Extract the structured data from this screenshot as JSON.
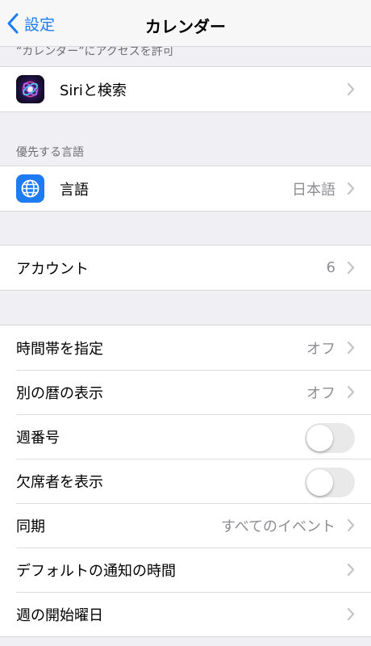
{
  "nav": {
    "back_label": "設定",
    "title": "カレンダー"
  },
  "access_header": "“カレンダー”にアクセスを許可",
  "siri_row": {
    "label": "Siriと検索",
    "icon": "siri-icon"
  },
  "lang_section": {
    "header": "優先する言語",
    "row": {
      "label": "言語",
      "value": "日本語",
      "icon": "globe-icon"
    }
  },
  "accounts": {
    "label": "アカウント",
    "value": "6"
  },
  "settings": {
    "timezone": {
      "label": "時間帯を指定",
      "value": "オフ"
    },
    "alt_calendar": {
      "label": "別の暦の表示",
      "value": "オフ"
    },
    "week_numbers": {
      "label": "週番号",
      "on": false
    },
    "declined": {
      "label": "欠席者を表示",
      "on": false
    },
    "sync": {
      "label": "同期",
      "value": "すべてのイベント"
    },
    "default_alert": {
      "label": "デフォルトの通知の時間"
    },
    "week_start": {
      "label": "週の開始曜日"
    }
  },
  "colors": {
    "accent": "#1b7cf5",
    "background": "#efeff4",
    "secondary_text": "#8e8e93"
  }
}
